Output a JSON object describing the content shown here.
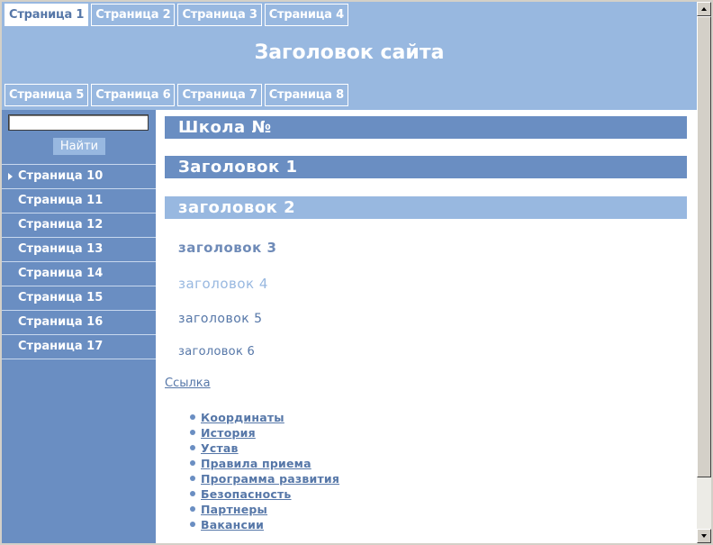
{
  "header": {
    "tabs_top": [
      {
        "label": "Страница 1",
        "active": true
      },
      {
        "label": "Страница 2",
        "active": false
      },
      {
        "label": "Страница 3",
        "active": false
      },
      {
        "label": "Страница 4",
        "active": false
      }
    ],
    "site_title": "Заголовок сайта",
    "tabs_bottom": [
      {
        "label": "Страница 5"
      },
      {
        "label": "Страница 6"
      },
      {
        "label": "Страница 7"
      },
      {
        "label": "Страница 8"
      }
    ]
  },
  "sidebar": {
    "search": {
      "value": "",
      "button_label": "Найти"
    },
    "items": [
      {
        "label": "Страница 10",
        "current": true
      },
      {
        "label": "Страница 11"
      },
      {
        "label": "Страница 12"
      },
      {
        "label": "Страница 13"
      },
      {
        "label": "Страница 14"
      },
      {
        "label": "Страница 15"
      },
      {
        "label": "Страница 16"
      },
      {
        "label": "Страница 17"
      }
    ]
  },
  "main": {
    "school_title": "Школа №",
    "h1": "Заголовок 1",
    "h2": "заголовок 2",
    "h3": "заголовок 3",
    "h4": "заголовок 4",
    "h5": "заголовок 5",
    "h6": "заголовок 6",
    "link": "Ссылка",
    "list": [
      "Координаты",
      "История",
      "Устав",
      "Правила приема",
      "Программа развития",
      "Безопасность",
      "Партнеры",
      "Вакансии"
    ]
  },
  "colors": {
    "header_bg": "#98b8e0",
    "sidebar_bg": "#6a8ec2",
    "link_color": "#5677a8"
  }
}
